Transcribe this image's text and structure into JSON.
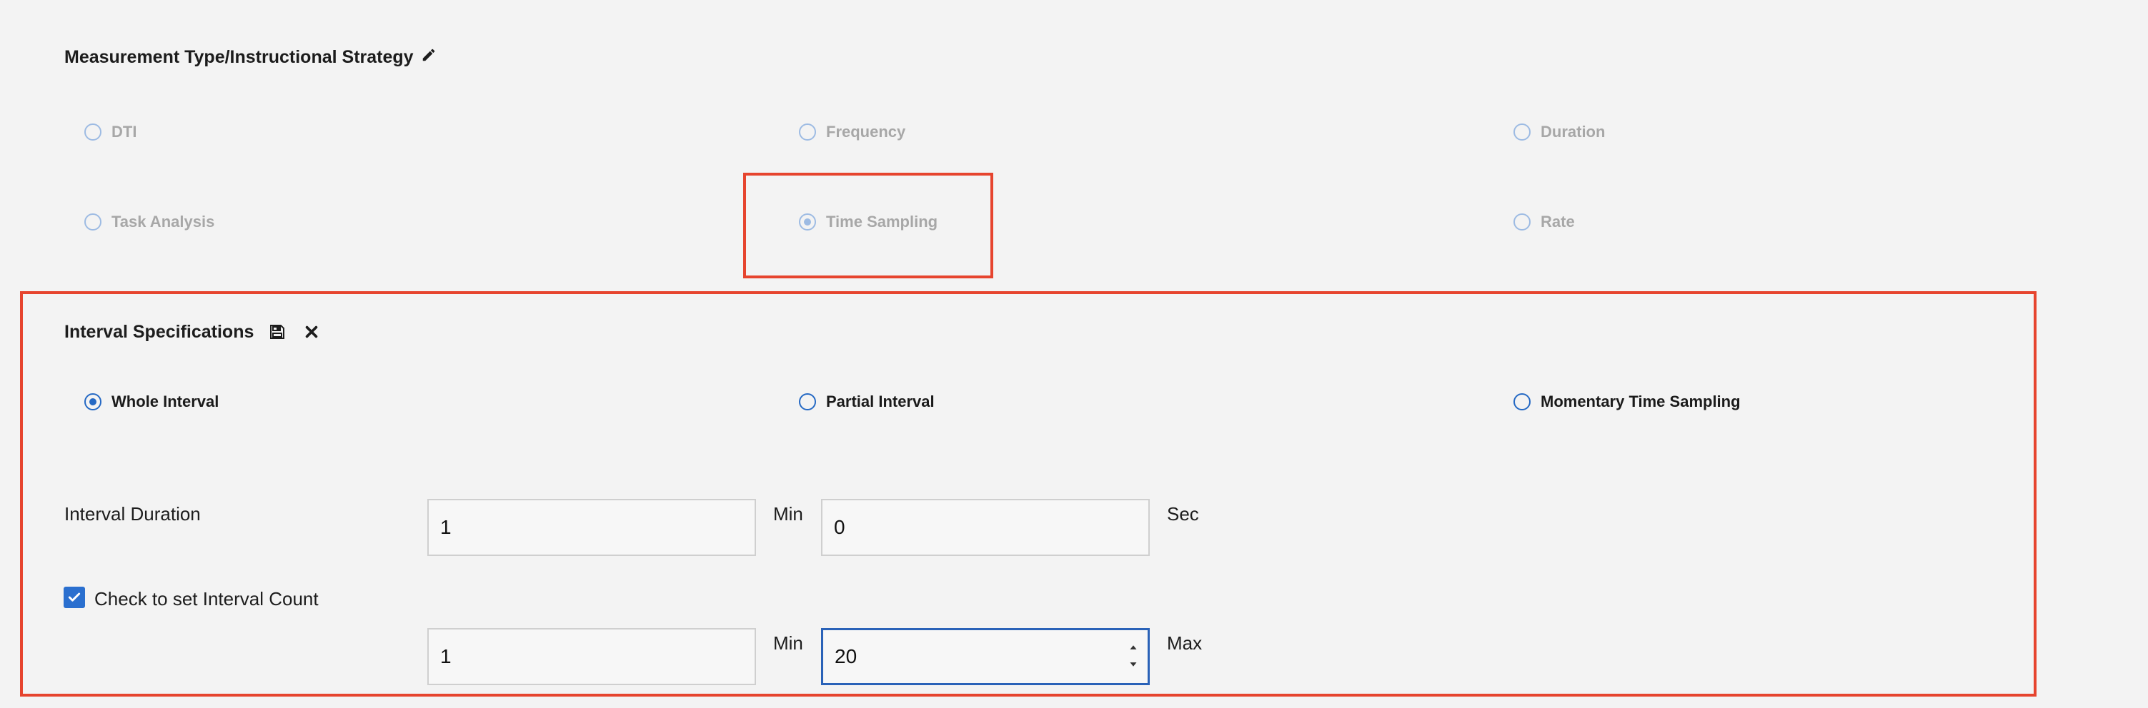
{
  "measurement": {
    "title": "Measurement Type/Instructional Strategy",
    "options": [
      {
        "label": "DTI",
        "checked": false
      },
      {
        "label": "Frequency",
        "checked": false
      },
      {
        "label": "Duration",
        "checked": false
      },
      {
        "label": "Task Analysis",
        "checked": false
      },
      {
        "label": "Time Sampling",
        "checked": true
      },
      {
        "label": "Rate",
        "checked": false
      }
    ]
  },
  "interval": {
    "title": "Interval Specifications",
    "options": [
      {
        "label": "Whole Interval",
        "checked": true
      },
      {
        "label": "Partial Interval",
        "checked": false
      },
      {
        "label": "Momentary Time Sampling",
        "checked": false
      }
    ],
    "duration_label": "Interval Duration",
    "duration_min_value": "1",
    "duration_min_unit": "Min",
    "duration_sec_value": "0",
    "duration_sec_unit": "Sec",
    "count_checkbox_label": "Check to set Interval Count",
    "count_checked": true,
    "count_min_value": "1",
    "count_min_unit": "Min",
    "count_max_value": "20",
    "count_max_unit": "Max"
  },
  "colors": {
    "highlight": "#e6442e",
    "accent": "#2569c4",
    "disabled_text": "#a7a7a7"
  },
  "icons": {
    "edit": "pencil-icon",
    "save": "floppy-disk-icon",
    "close": "close-icon",
    "check": "checkmark-icon",
    "spinner": "spinner-arrows-icon"
  }
}
